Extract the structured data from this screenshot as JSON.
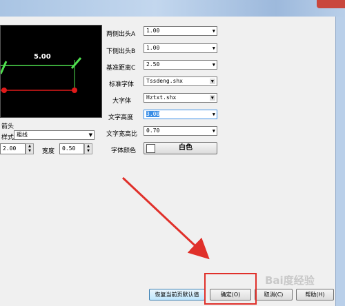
{
  "preview": {
    "dimension_text": "5.00"
  },
  "arrow_section": {
    "title": "箭头",
    "style_label": "样式",
    "style_value": "粗线",
    "size_value": "2.00",
    "width_label": "宽度",
    "width_value": "0.50"
  },
  "params": [
    {
      "label": "两侧出头A",
      "value": "1.00"
    },
    {
      "label": "下侧出头B",
      "value": "1.00"
    },
    {
      "label": "基准距离C",
      "value": "2.50"
    },
    {
      "label": "标准字体",
      "value": "Tssdeng.shx"
    },
    {
      "label": "大字体",
      "value": "Hztxt.shx"
    },
    {
      "label": "文字高度",
      "value": "3.00"
    },
    {
      "label": "文字宽高比",
      "value": "0.70"
    }
  ],
  "font_color": {
    "label": "字体颜色",
    "value": "白色"
  },
  "buttons": {
    "restore": "恢复当前页默认值",
    "ok": "确定(O)",
    "cancel": "取消(C)",
    "help": "帮助(H)"
  },
  "watermark": "Bai度经验",
  "colors": {
    "accent_red": "#e0302a",
    "preview_green": "#4fe04f",
    "preview_red": "#e01a1a",
    "selection": "#3a8ee6"
  },
  "icons": [
    "dropdown-arrow-icon",
    "spin-up-icon",
    "spin-down-icon",
    "annotation-arrow-icon",
    "close-icon"
  ]
}
